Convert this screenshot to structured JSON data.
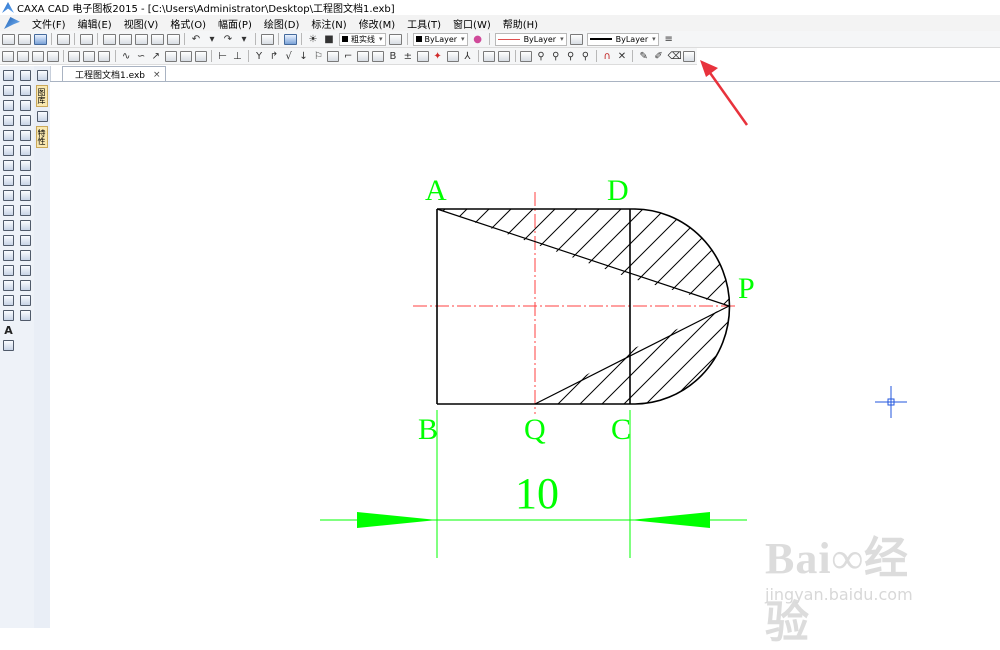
{
  "window": {
    "title": "CAXA CAD 电子图板2015 - [C:\\Users\\Administrator\\Desktop\\工程图文档1.exb]"
  },
  "menu": {
    "items": [
      "文件(F)",
      "编辑(E)",
      "视图(V)",
      "格式(O)",
      "幅面(P)",
      "绘图(D)",
      "标注(N)",
      "修改(M)",
      "工具(T)",
      "窗口(W)",
      "帮助(H)"
    ]
  },
  "toolbar": {
    "linestyle_label": "粗实线",
    "color_label": "ByLayer",
    "linetype_label": "ByLayer",
    "lineweight_label": "ByLayer"
  },
  "sidebar": {
    "tab1": "图库",
    "tab2": "特性"
  },
  "document": {
    "tab_label": "工程图文档1.exb",
    "close_glyph": "×"
  },
  "drawing": {
    "point_labels": {
      "A": "A",
      "D": "D",
      "P": "P",
      "B": "B",
      "Q": "Q",
      "C": "C"
    },
    "dimension_text": "10",
    "colors": {
      "label": "#00ff00",
      "centerline": "#ff4040",
      "geometry": "#000000",
      "dimension": "#00ff00",
      "cursor": "#2255dd",
      "arrow": "#e8323c"
    }
  },
  "watermark": {
    "title": "Bai∞经验",
    "subtitle": "jingyan.baidu.com"
  }
}
